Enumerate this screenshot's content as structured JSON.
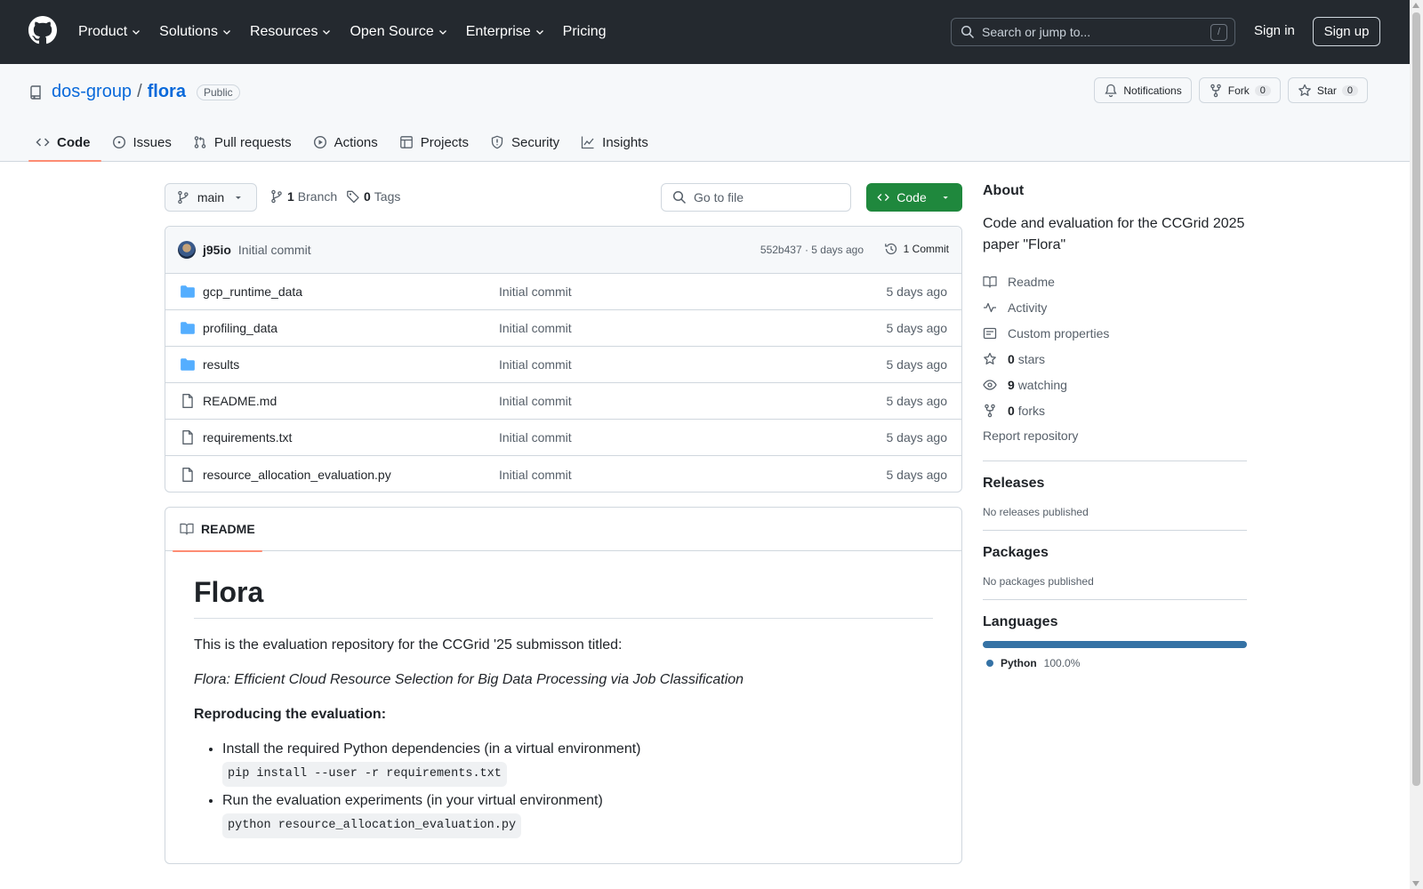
{
  "header": {
    "nav": [
      "Product",
      "Solutions",
      "Resources",
      "Open Source",
      "Enterprise",
      "Pricing"
    ],
    "search_placeholder": "Search or jump to...",
    "search_shortcut": "/",
    "sign_in": "Sign in",
    "sign_up": "Sign up"
  },
  "repo": {
    "owner": "dos-group",
    "separator": "/",
    "name": "flora",
    "visibility": "Public",
    "notifications_label": "Notifications",
    "fork_label": "Fork",
    "fork_count": "0",
    "star_label": "Star",
    "star_count": "0",
    "tabs": [
      "Code",
      "Issues",
      "Pull requests",
      "Actions",
      "Projects",
      "Security",
      "Insights"
    ]
  },
  "toolbar": {
    "branch": "main",
    "branch_count": "1",
    "branch_label": "Branch",
    "tag_count": "0",
    "tag_label": "Tags",
    "goto_placeholder": "Go to file",
    "code_label": "Code"
  },
  "commit": {
    "author": "j95io",
    "message": "Initial commit",
    "meta": "552b437 · 5 days ago",
    "count_label": "1 Commit"
  },
  "files": [
    {
      "name": "gcp_runtime_data",
      "type": "dir",
      "message": "Initial commit",
      "date": "5 days ago"
    },
    {
      "name": "profiling_data",
      "type": "dir",
      "message": "Initial commit",
      "date": "5 days ago"
    },
    {
      "name": "results",
      "type": "dir",
      "message": "Initial commit",
      "date": "5 days ago"
    },
    {
      "name": "README.md",
      "type": "file",
      "message": "Initial commit",
      "date": "5 days ago"
    },
    {
      "name": "requirements.txt",
      "type": "file",
      "message": "Initial commit",
      "date": "5 days ago"
    },
    {
      "name": "resource_allocation_evaluation.py",
      "type": "file",
      "message": "Initial commit",
      "date": "5 days ago"
    }
  ],
  "readme": {
    "tab_label": "README",
    "title": "Flora",
    "intro": "This is the evaluation repository for the CCGrid '25 submisson titled:",
    "paper_title": "Flora: Efficient Cloud Resource Selection for Big Data Processing via Job Classification",
    "section": "Reproducing the evaluation:",
    "steps": [
      {
        "text": "Install the required Python dependencies (in a virtual environment)",
        "code": "pip install --user -r requirements.txt"
      },
      {
        "text": "Run the evaluation experiments (in your virtual environment)",
        "code": "python resource_allocation_evaluation.py"
      }
    ]
  },
  "sidebar": {
    "about_title": "About",
    "description": "Code and evaluation for the CCGrid 2025 paper \"Flora\"",
    "readme": "Readme",
    "activity": "Activity",
    "custom_properties": "Custom properties",
    "stars_count": "0",
    "stars_label": "stars",
    "watching_count": "9",
    "watching_label": "watching",
    "forks_count": "0",
    "forks_label": "forks",
    "report": "Report repository",
    "releases_title": "Releases",
    "releases_text": "No releases published",
    "packages_title": "Packages",
    "packages_text": "No packages published",
    "languages_title": "Languages",
    "language": "Python",
    "language_pct": "100.0%",
    "language_color": "#3572a5"
  }
}
